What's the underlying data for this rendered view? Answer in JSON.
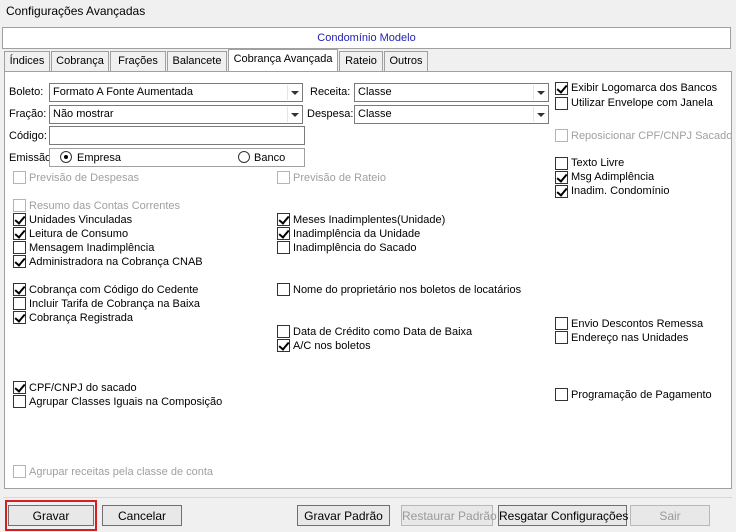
{
  "window": {
    "title": "Configurações Avançadas"
  },
  "banner": {
    "text": "Condomínio Modelo"
  },
  "tabs": [
    {
      "label": "Índices"
    },
    {
      "label": "Cobrança"
    },
    {
      "label": "Frações"
    },
    {
      "label": "Balancete"
    },
    {
      "label": "Cobrança Avançada",
      "active": true
    },
    {
      "label": "Rateio"
    },
    {
      "label": "Outros"
    }
  ],
  "form": {
    "boleto": {
      "label": "Boleto:",
      "value": "Formato A Fonte Aumentada"
    },
    "fracao": {
      "label": "Fração:",
      "value": "Não mostrar"
    },
    "codigo": {
      "label": "Código:",
      "value": ""
    },
    "emissao": {
      "label": "Emissão:",
      "options": [
        "Empresa",
        "Banco"
      ],
      "selected": "Empresa"
    },
    "receita": {
      "label": "Receita:",
      "value": "Classe"
    },
    "despesa": {
      "label": "Despesa:",
      "value": "Classe"
    }
  },
  "checkboxes": {
    "exibir_logomarca": {
      "label": "Exibir Logomarca dos Bancos",
      "checked": true,
      "enabled": true
    },
    "utilizar_envelope": {
      "label": "Utilizar Envelope com Janela",
      "checked": false,
      "enabled": true
    },
    "reposicionar_cpf": {
      "label": "Reposicionar CPF/CNPJ Sacado",
      "checked": false,
      "enabled": false
    },
    "texto_livre": {
      "label": "Texto Livre",
      "checked": false,
      "enabled": true
    },
    "msg_adimplencia": {
      "label": "Msg Adimplência",
      "checked": true,
      "enabled": true
    },
    "inadim_condominio": {
      "label": "Inadim. Condomínio",
      "checked": true,
      "enabled": true
    },
    "previsao_despesas": {
      "label": "Previsão de Despesas",
      "checked": false,
      "enabled": false
    },
    "previsao_rateio": {
      "label": "Previsão de Rateio",
      "checked": false,
      "enabled": false
    },
    "resumo_contas": {
      "label": "Resumo das Contas Correntes",
      "checked": false,
      "enabled": false
    },
    "unidades_vinculadas": {
      "label": "Unidades Vinculadas",
      "checked": true,
      "enabled": true
    },
    "leitura_consumo": {
      "label": "Leitura de Consumo",
      "checked": true,
      "enabled": true
    },
    "mensagem_inadimplencia": {
      "label": "Mensagem Inadimplência",
      "checked": false,
      "enabled": true
    },
    "administradora_cnab": {
      "label": "Administradora na Cobrança CNAB",
      "checked": true,
      "enabled": true
    },
    "meses_inadimplentes": {
      "label": "Meses Inadimplentes(Unidade)",
      "checked": true,
      "enabled": true
    },
    "inadimplencia_unidade": {
      "label": "Inadimplência da Unidade",
      "checked": true,
      "enabled": true
    },
    "inadimplencia_sacado": {
      "label": "Inadimplência do Sacado",
      "checked": false,
      "enabled": true
    },
    "cobranca_codigo_cedente": {
      "label": "Cobrança com Código do Cedente",
      "checked": true,
      "enabled": true
    },
    "incluir_tarifa": {
      "label": "Incluir Tarifa de Cobrança na Baixa",
      "checked": false,
      "enabled": true
    },
    "cobranca_registrada": {
      "label": "Cobrança Registrada",
      "checked": true,
      "enabled": true
    },
    "nome_proprietario": {
      "label": "Nome do proprietário nos boletos de locatários",
      "checked": false,
      "enabled": true
    },
    "envio_descontos": {
      "label": "Envio Descontos Remessa",
      "checked": false,
      "enabled": true
    },
    "endereco_unidades": {
      "label": "Endereço nas Unidades",
      "checked": false,
      "enabled": true
    },
    "data_credito": {
      "label": "Data de Crédito como Data de Baixa",
      "checked": false,
      "enabled": true
    },
    "ac_boletos": {
      "label": "A/C nos boletos",
      "checked": true,
      "enabled": true
    },
    "cpf_cnpj_sacado": {
      "label": "CPF/CNPJ do sacado",
      "checked": true,
      "enabled": true
    },
    "agrupar_classes": {
      "label": "Agrupar Classes Iguais na Composição",
      "checked": false,
      "enabled": true
    },
    "programacao_pagamento": {
      "label": "Programação de Pagamento",
      "checked": false,
      "enabled": true
    },
    "agrupar_receitas": {
      "label": "Agrupar receitas pela classe de conta",
      "checked": false,
      "enabled": false
    }
  },
  "buttons": {
    "gravar": {
      "label": "Gravar",
      "enabled": true
    },
    "cancelar": {
      "label": "Cancelar",
      "enabled": true
    },
    "gravar_padrao": {
      "label": "Gravar Padrão",
      "enabled": true
    },
    "restaurar_padrao": {
      "label": "Restaurar Padrão",
      "enabled": false
    },
    "resgatar_config": {
      "label": "Resgatar Configurações",
      "enabled": true
    },
    "sair": {
      "label": "Sair",
      "enabled": false
    }
  },
  "colors": {
    "banner_text": "#1f1fae",
    "highlight": "#d42020"
  }
}
